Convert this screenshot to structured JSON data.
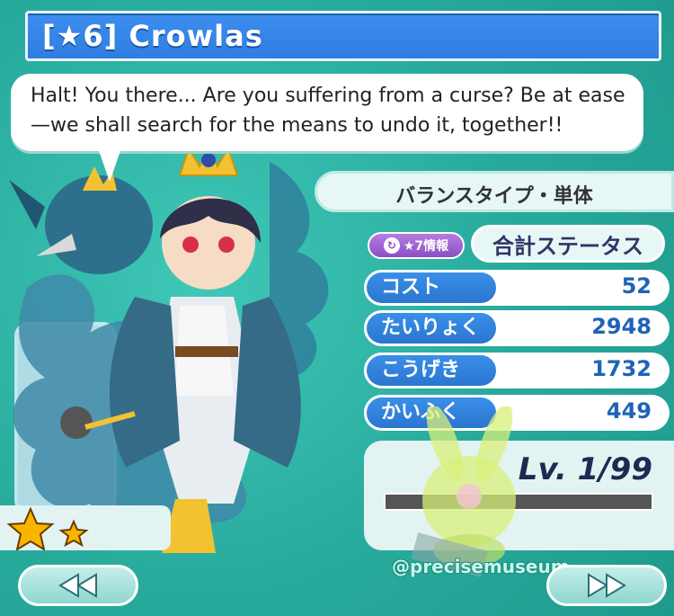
{
  "title": "[★6] Crowlas",
  "dialogue": "Halt! You there... Are you suffering from a curse? Be at ease—we shall search for the means to undo it, together!!",
  "type_label": "バランスタイプ・単体",
  "info_button": {
    "label": "★7情報",
    "icon": "refresh-icon"
  },
  "total_status_label": "合計ステータス",
  "stats": [
    {
      "label": "コスト",
      "value": "52"
    },
    {
      "label": "たいりょく",
      "value": "2948"
    },
    {
      "label": "こうげき",
      "value": "1732"
    },
    {
      "label": "かいふく",
      "value": "449"
    }
  ],
  "level": {
    "text": "Lv. 1/99",
    "current": 1,
    "max": 99,
    "progress_fraction": 0.0
  },
  "rarity": {
    "large_stars": 1,
    "small_stars": 1
  },
  "nav": {
    "prev_icon": "double-chevron-left-icon",
    "next_icon": "double-chevron-right-icon"
  },
  "watermark": "@precisemuseum",
  "colors": {
    "background": "#2bb3a6",
    "title_bar": "#3d8ef0",
    "stat_label": "#3a8fe8",
    "info_button": "#8c4fc4"
  }
}
